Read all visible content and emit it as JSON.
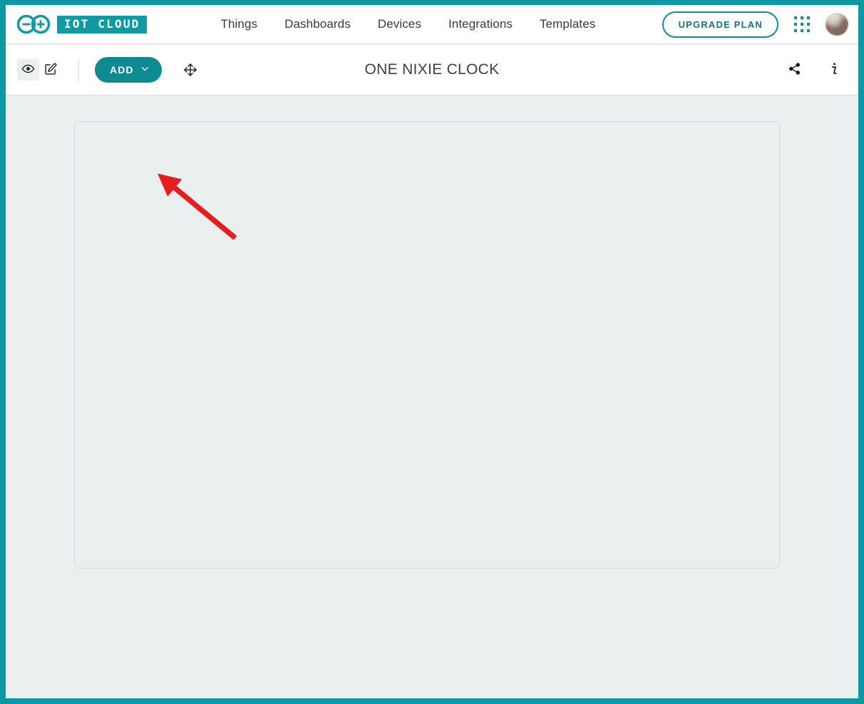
{
  "brand": {
    "logo_icon": "arduino-infinity-logo-icon",
    "badge_text": "IOT CLOUD"
  },
  "header": {
    "nav": [
      {
        "label": "Things",
        "name": "nav-things"
      },
      {
        "label": "Dashboards",
        "name": "nav-dashboards"
      },
      {
        "label": "Devices",
        "name": "nav-devices"
      },
      {
        "label": "Integrations",
        "name": "nav-integrations"
      },
      {
        "label": "Templates",
        "name": "nav-templates"
      }
    ],
    "upgrade_label": "UPGRADE PLAN",
    "apps_icon": "apps-grid-icon",
    "avatar_icon": "user-avatar"
  },
  "toolbar": {
    "view_mode_icon": "eye-icon",
    "edit_mode_icon": "edit-pencil-square-icon",
    "active_mode": "edit",
    "add_label": "ADD",
    "add_chevron_icon": "chevron-down-icon",
    "move_icon": "move-arrows-icon",
    "title": "ONE NIXIE CLOCK",
    "share_icon": "share-icon",
    "info_icon": "info-icon"
  },
  "canvas": {
    "widget_area_name": "empty-widget-canvas",
    "widgets": []
  },
  "annotation": {
    "arrow_color": "#e81c1c",
    "points_to": "add-button"
  },
  "colors": {
    "brand_teal": "#0d99a4",
    "button_teal": "#0e8a92",
    "canvas_bg": "#eaeff0",
    "border_grey": "#d3d9da"
  }
}
